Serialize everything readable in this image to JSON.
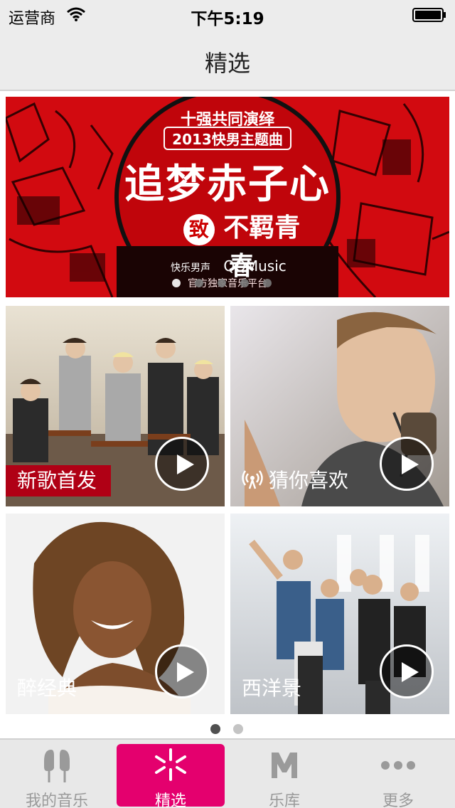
{
  "status_bar": {
    "carrier": "运营商",
    "time": "下午5:19"
  },
  "nav": {
    "title": "精选"
  },
  "banner": {
    "line1": "十强共同演绎",
    "line2": "2013快男主题曲",
    "line3": "追梦赤子心",
    "line4": "不羁青春",
    "badge": "致",
    "logo_text": "快乐男声",
    "brand": "QQMusic",
    "sub": "官方独家音乐平台",
    "page_count": 5,
    "active_index": 0
  },
  "tiles": [
    {
      "label": "新歌首发",
      "play_icon": "play-icon"
    },
    {
      "label": "猜你喜欢",
      "play_icon": "play-icon",
      "label_icon": "radio-icon"
    },
    {
      "label": "醉经典",
      "play_icon": "play-icon"
    },
    {
      "label": "西洋景",
      "play_icon": "play-icon"
    }
  ],
  "pager": {
    "page_count": 2,
    "active_index": 0
  },
  "tab_bar": {
    "accent": "#e4006e",
    "items": [
      {
        "label": "我的音乐",
        "icon": "earphones-icon"
      },
      {
        "label": "精选",
        "icon": "sparkle-icon",
        "active": true
      },
      {
        "label": "乐库",
        "icon": "m-logo-icon"
      },
      {
        "label": "更多",
        "icon": "more-dots-icon"
      }
    ]
  }
}
